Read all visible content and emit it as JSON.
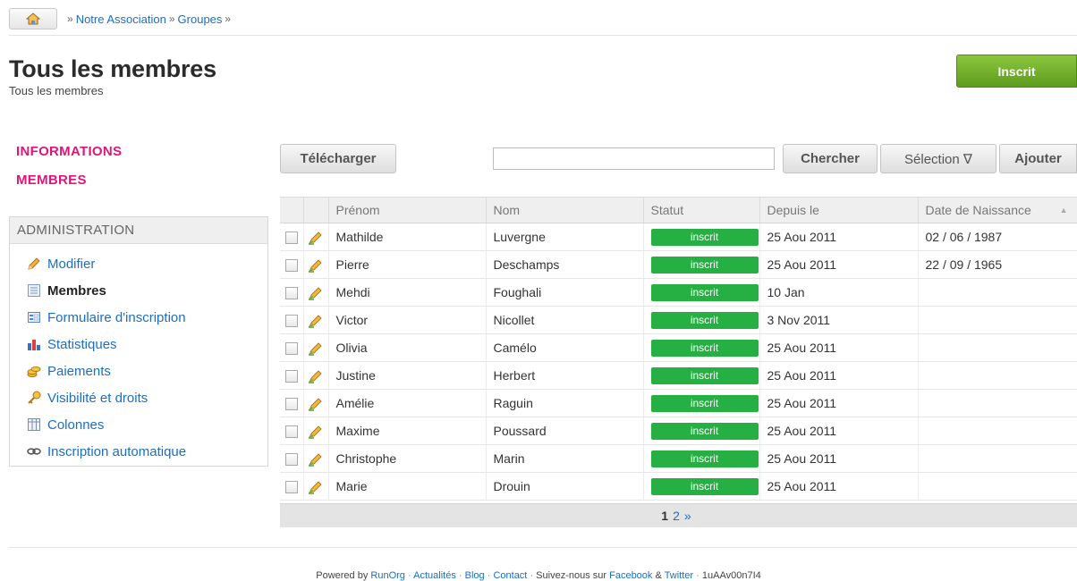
{
  "breadcrumb": {
    "sep": "»",
    "items": [
      "Notre Association",
      "Groupes"
    ]
  },
  "page": {
    "title": "Tous les membres",
    "subtitle": "Tous les membres"
  },
  "header_action": {
    "label": "Inscrit",
    "color": "#6aab2a"
  },
  "nav": {
    "top_items": [
      "INFORMATIONS",
      "MEMBRES"
    ],
    "admin_title": "ADMINISTRATION",
    "admin_items": [
      {
        "label": "Modifier",
        "icon": "pencil-icon"
      },
      {
        "label": "Membres",
        "icon": "list-icon",
        "active": true
      },
      {
        "label": "Formulaire d'inscription",
        "icon": "form-icon"
      },
      {
        "label": "Statistiques",
        "icon": "bar-chart-icon"
      },
      {
        "label": "Paiements",
        "icon": "coins-icon"
      },
      {
        "label": "Visibilité et droits",
        "icon": "key-icon"
      },
      {
        "label": "Colonnes",
        "icon": "columns-icon"
      },
      {
        "label": "Inscription automatique",
        "icon": "link-icon"
      }
    ]
  },
  "toolbar": {
    "download": "Télécharger",
    "search_value": "",
    "search_button": "Chercher",
    "selection": "Sélection ∇",
    "add": "Ajouter"
  },
  "table": {
    "columns": [
      "Prénom",
      "Nom",
      "Statut",
      "Depuis le",
      "Date de Naissance"
    ],
    "sort_indicator": "▲",
    "status_color": "#26b043",
    "rows": [
      {
        "first": "Mathilde",
        "last": "Luvergne",
        "status": "inscrit",
        "since": "25 Aou 2011",
        "birth": "02 / 06 / 1987"
      },
      {
        "first": "Pierre",
        "last": "Deschamps",
        "status": "inscrit",
        "since": "25 Aou 2011",
        "birth": "22 / 09 / 1965"
      },
      {
        "first": "Mehdi",
        "last": "Foughali",
        "status": "inscrit",
        "since": "10 Jan",
        "birth": ""
      },
      {
        "first": "Victor",
        "last": "Nicollet",
        "status": "inscrit",
        "since": "3 Nov 2011",
        "birth": ""
      },
      {
        "first": "Olivia",
        "last": "Camélo",
        "status": "inscrit",
        "since": "25 Aou 2011",
        "birth": ""
      },
      {
        "first": "Justine",
        "last": "Herbert",
        "status": "inscrit",
        "since": "25 Aou 2011",
        "birth": ""
      },
      {
        "first": "Amélie",
        "last": "Raguin",
        "status": "inscrit",
        "since": "25 Aou 2011",
        "birth": ""
      },
      {
        "first": "Maxime",
        "last": "Poussard",
        "status": "inscrit",
        "since": "25 Aou 2011",
        "birth": ""
      },
      {
        "first": "Christophe",
        "last": "Marin",
        "status": "inscrit",
        "since": "25 Aou 2011",
        "birth": ""
      },
      {
        "first": "Marie",
        "last": "Drouin",
        "status": "inscrit",
        "since": "25 Aou 2011",
        "birth": ""
      }
    ]
  },
  "pagination": {
    "current": "1",
    "next_page": "2",
    "next": "»"
  },
  "footer": {
    "powered": "Powered by",
    "brand": "RunOrg",
    "sep": "·",
    "news": "Actualités",
    "blog": "Blog",
    "contact": "Contact",
    "follow": "Suivez-nous sur",
    "facebook": "Facebook",
    "amp": "&",
    "twitter": "Twitter",
    "code": "1uAAv00n7I4"
  }
}
